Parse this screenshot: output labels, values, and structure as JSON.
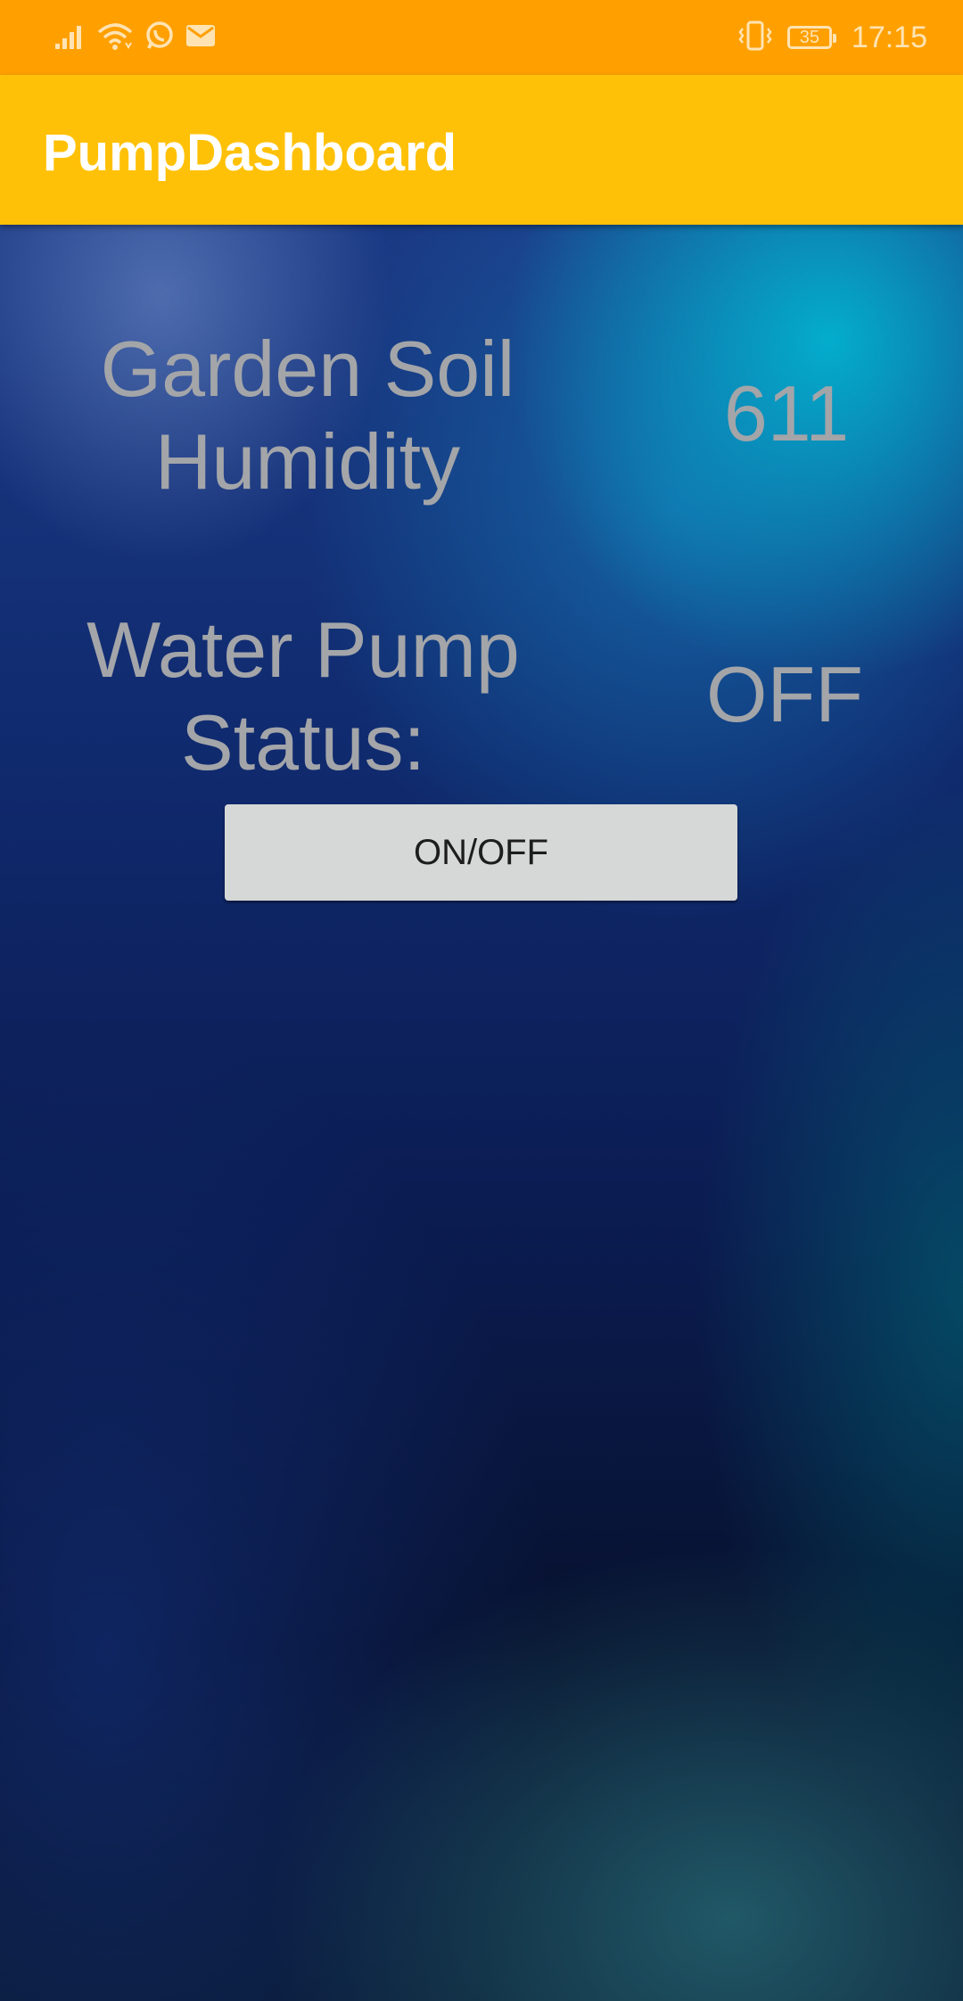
{
  "status_bar": {
    "time": "17:15",
    "battery_level": "35",
    "icons": [
      "signal-icon",
      "wifi-icon",
      "whatsapp-icon",
      "mail-icon",
      "vibrate-icon",
      "battery-icon"
    ],
    "text_color": "#ffe3b3",
    "background": "#ffa000"
  },
  "app_bar": {
    "title": "PumpDashboard",
    "background": "#ffc107"
  },
  "main": {
    "humidity": {
      "label": "Garden Soil Humidity",
      "value": "611"
    },
    "pump": {
      "label": "Water Pump Status:",
      "value": "OFF"
    },
    "toggle_button_label": "ON/OFF"
  }
}
